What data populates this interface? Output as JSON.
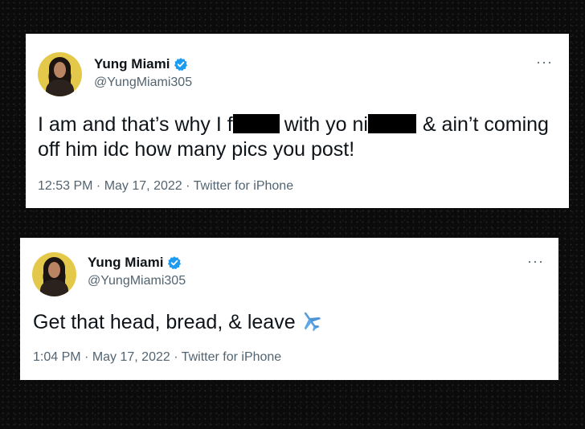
{
  "tweets": [
    {
      "name": "Yung Miami",
      "handle": "@YungMiami305",
      "text_part1": "I am and that’s why I f",
      "text_part2": "with yo ni",
      "text_part3": "& ain’t coming off him idc how many pics you post!",
      "time": "12:53 PM",
      "date": "May 17, 2022",
      "source": "Twitter for iPhone",
      "more": "···"
    },
    {
      "name": "Yung Miami",
      "handle": "@YungMiami305",
      "text": "Get that head, bread, & leave",
      "time": "1:04 PM",
      "date": "May 17, 2022",
      "source": "Twitter for iPhone",
      "more": "···"
    }
  ],
  "separator": " · ",
  "colors": {
    "verified": "#1d9bf0",
    "secondary_text": "#536471",
    "primary_text": "#0f1419",
    "background": "#0b0b0b"
  },
  "icons": {
    "verified": "verified-badge-icon",
    "more": "more-options-icon",
    "plane": "airplane-emoji-icon"
  }
}
